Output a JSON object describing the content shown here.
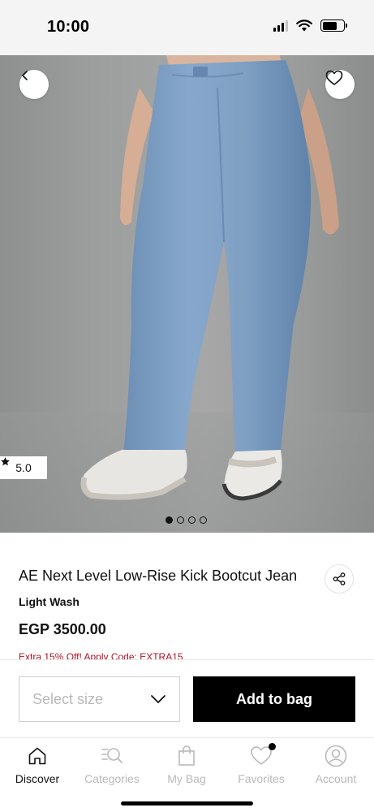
{
  "status_bar": {
    "time": "10:00"
  },
  "product": {
    "title": "AE Next Level Low-Rise Kick Bootcut Jean",
    "color": "Light Wash",
    "price": "EGP 3500.00",
    "promo": "Extra 15% Off! Apply Code: EXTRA15",
    "rating": "5.0",
    "image_count": 4,
    "active_image": 1
  },
  "actions": {
    "size_placeholder": "Select size",
    "add_to_bag": "Add to bag"
  },
  "nav": {
    "items": [
      {
        "label": "Discover",
        "icon": "home-icon",
        "active": true
      },
      {
        "label": "Categories",
        "icon": "categories-search-icon",
        "active": false
      },
      {
        "label": "My Bag",
        "icon": "shopping-bag-icon",
        "active": false
      },
      {
        "label": "Favorites",
        "icon": "heart-icon",
        "active": false
      },
      {
        "label": "Account",
        "icon": "user-icon",
        "active": false
      }
    ]
  },
  "colors": {
    "accent": "#000000",
    "promo": "#b11226",
    "inactive": "#b9b9b9",
    "denim": "#7a9cc2"
  }
}
